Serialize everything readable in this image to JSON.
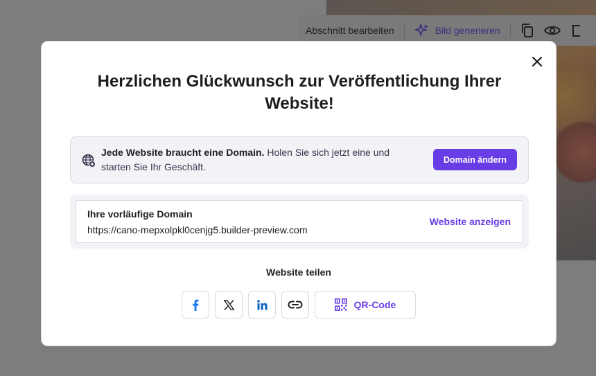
{
  "background": {
    "toolbar": {
      "edit_section": "Abschnitt bearbeiten",
      "generate_image": "Bild generieren"
    }
  },
  "modal": {
    "title": "Herzlichen Glückwunsch zur Veröffentlichung Ihrer Website!",
    "banner": {
      "bold_text": "Jede Website braucht eine Domain.",
      "text": " Holen Sie sich jetzt eine und starten Sie Ihr Geschäft.",
      "button_label": "Domain ändern"
    },
    "domain": {
      "label": "Ihre vorläufige Domain",
      "url": "https://cano-mepxolpkl0cenjg5.builder-preview.com",
      "view_link": "Website anzeigen"
    },
    "share": {
      "title": "Website teilen",
      "qr_label": "QR-Code"
    }
  },
  "colors": {
    "accent": "#673de6",
    "facebook": "#1877f2",
    "linkedin": "#0a66c2"
  },
  "icons": [
    "close-icon",
    "globe-icon",
    "facebook-icon",
    "x-icon",
    "linkedin-icon",
    "link-icon",
    "qr-code-icon",
    "sparkle-icon",
    "copy-icon",
    "eye-icon"
  ]
}
